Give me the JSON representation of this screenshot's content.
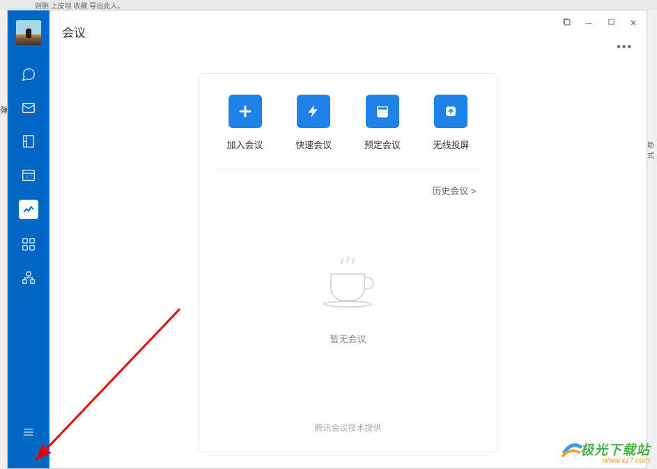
{
  "bg_top_text": "则删    上皮坝    收藏    导出此人。",
  "page_title": "会议",
  "sidebar": {
    "items": [
      {
        "name": "chat-icon"
      },
      {
        "name": "mail-icon"
      },
      {
        "name": "docs-icon"
      },
      {
        "name": "calendar-icon"
      },
      {
        "name": "meeting-icon",
        "active": true
      },
      {
        "name": "apps-icon"
      },
      {
        "name": "workbench-icon"
      }
    ]
  },
  "actions": [
    {
      "label": "加入会议",
      "icon": "plus"
    },
    {
      "label": "快速会议",
      "icon": "bolt"
    },
    {
      "label": "预定会议",
      "icon": "schedule"
    },
    {
      "label": "无线投屏",
      "icon": "cast"
    }
  ],
  "history_link": "历史会议 >",
  "empty_text": "暂无会议",
  "footer_text": "腾讯会议技术提供",
  "watermark": {
    "main": "极光下载站",
    "sub": "www.xz7.com"
  },
  "bg_side": "助式"
}
